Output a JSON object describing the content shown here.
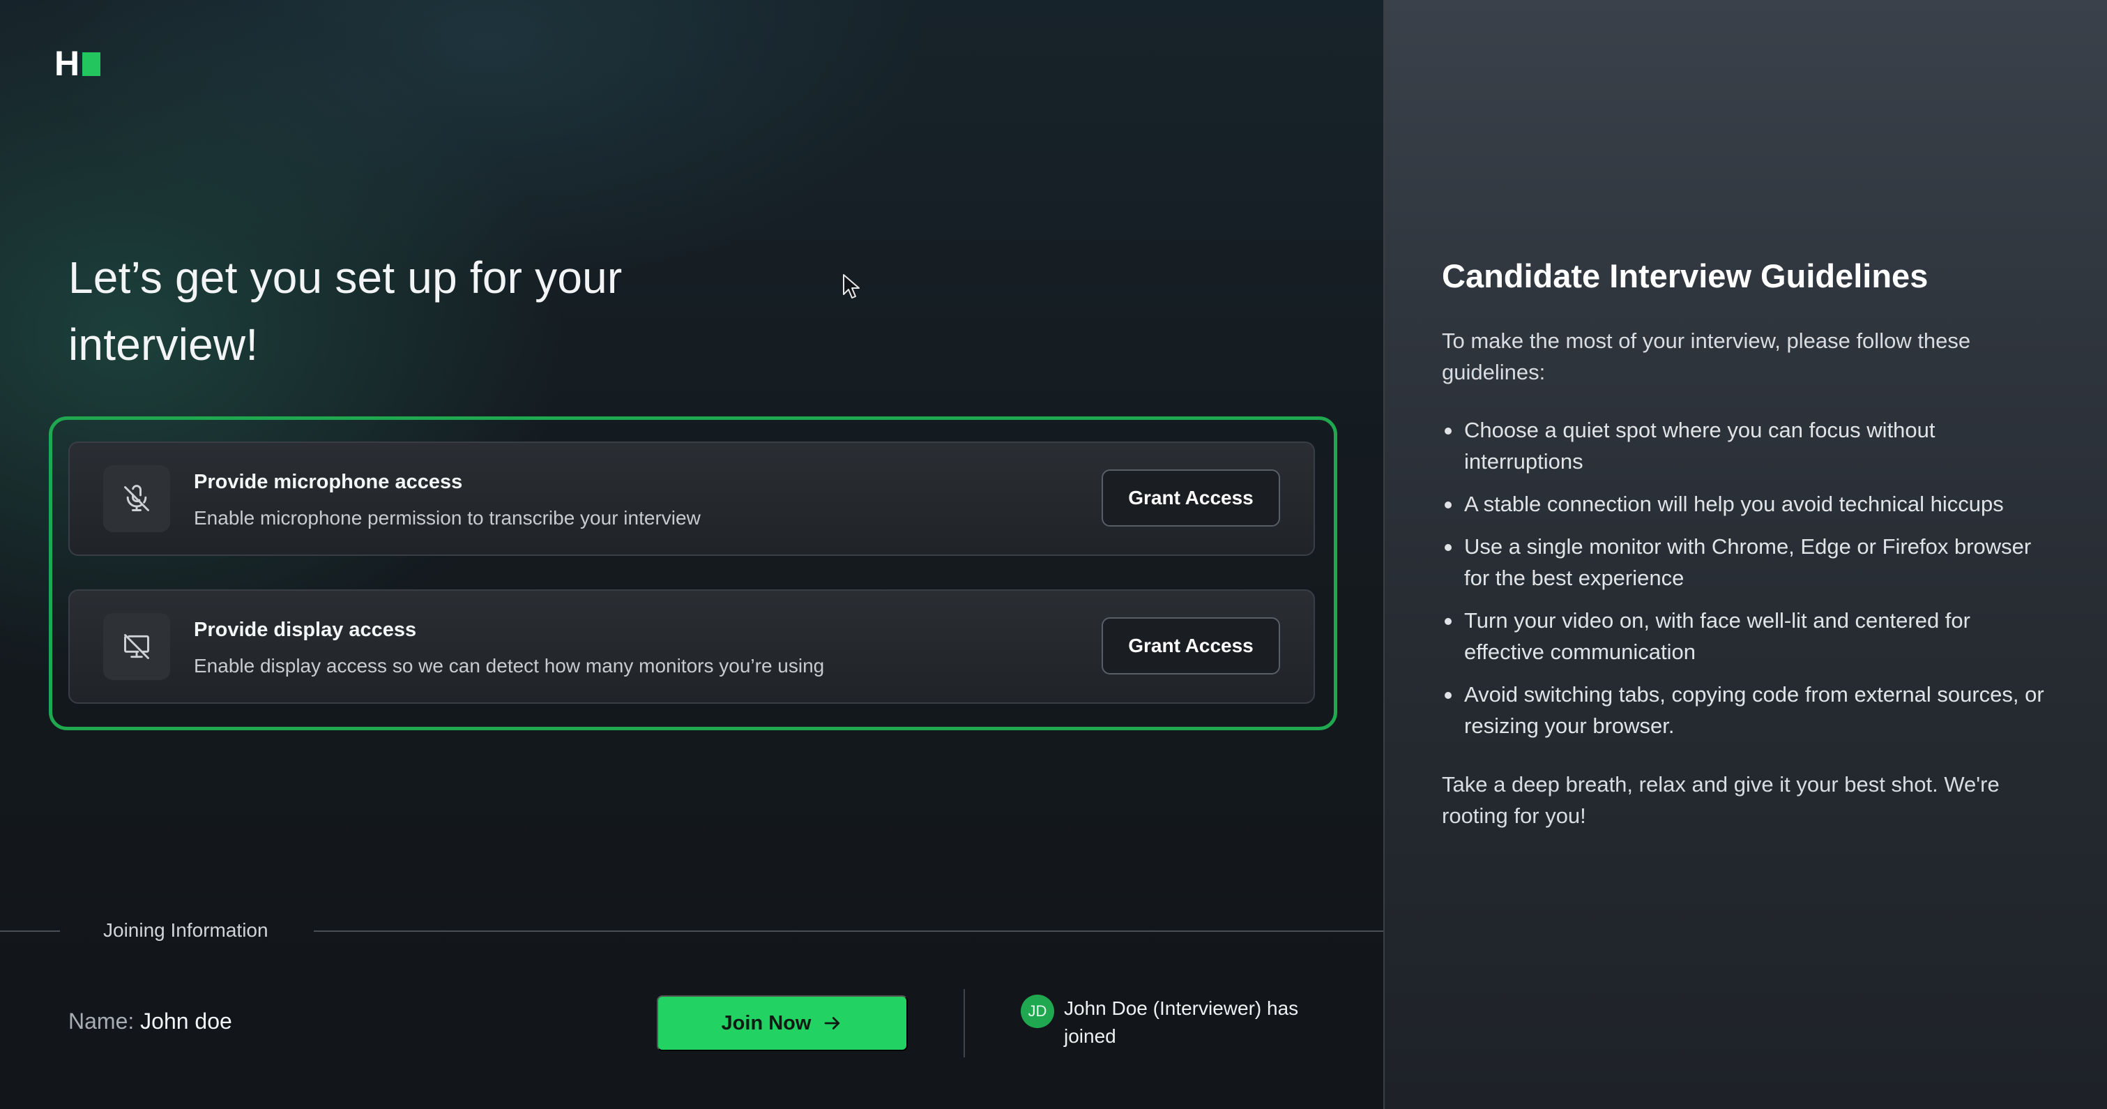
{
  "logo": {
    "letter": "H",
    "accent_color": "#22c55e"
  },
  "setup": {
    "heading": "Let’s get you set up for your interview!",
    "cards": [
      {
        "icon": "microphone-off-icon",
        "title": "Provide microphone access",
        "description": "Enable microphone permission to transcribe your interview",
        "button_label": "Grant Access"
      },
      {
        "icon": "monitor-off-icon",
        "title": "Provide display access",
        "description": "Enable display access so we can detect how many monitors you’re using",
        "button_label": "Grant Access"
      }
    ],
    "highlight_color": "#1fa84f"
  },
  "joining": {
    "section_label": "Joining Information",
    "name_label": "Name:",
    "name_value": "John doe",
    "join_button_label": "Join Now",
    "join_button_color": "#22d364",
    "participant_initials": "JD",
    "participant_status": "John Doe (Interviewer) has joined"
  },
  "guidelines": {
    "title": "Candidate Interview Guidelines",
    "intro": "To make the most of your interview, please follow these guidelines:",
    "items": [
      "Choose a quiet spot where you can focus without interruptions",
      "A stable connection will help you avoid technical hiccups",
      "Use a single monitor with Chrome, Edge or Firefox browser for the best experience",
      "Turn your video on, with face well-lit and centered for effective communication",
      "Avoid switching tabs, copying code from external sources, or resizing your browser."
    ],
    "outro": "Take a deep breath, relax and give it your best shot. We're rooting for you!"
  }
}
